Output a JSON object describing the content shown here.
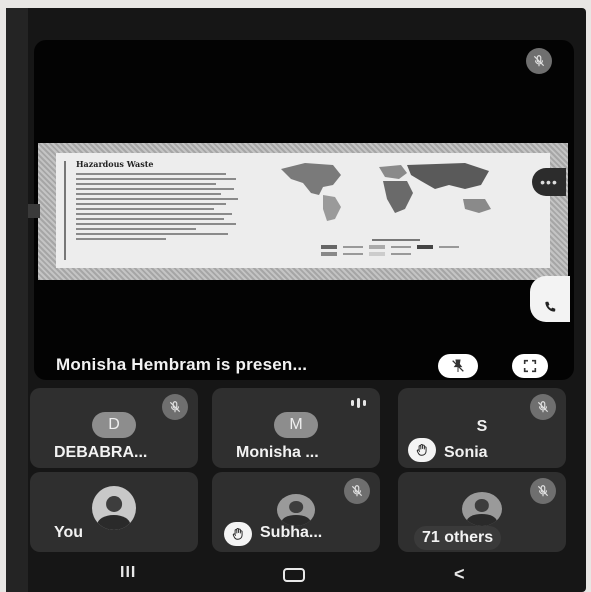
{
  "stage": {
    "slide": {
      "heading": "Hazardous Waste"
    },
    "presenter_text": "Monisha Hembram is presen..."
  },
  "participants": [
    {
      "initial": "D",
      "name": "DEBABRA...",
      "muted": true
    },
    {
      "initial": "M",
      "name": "Monisha ...",
      "muted": false,
      "speaking": true
    },
    {
      "initial": "S",
      "name": "Sonia",
      "muted": true,
      "hand_raised": true
    },
    {
      "name": "You",
      "photo": true
    },
    {
      "name": "Subha...",
      "muted": true,
      "hand_raised": true,
      "photo": true
    },
    {
      "name": "71 others",
      "muted": true,
      "photo": true
    }
  ],
  "nav": {
    "recents": "III",
    "back": "<"
  }
}
